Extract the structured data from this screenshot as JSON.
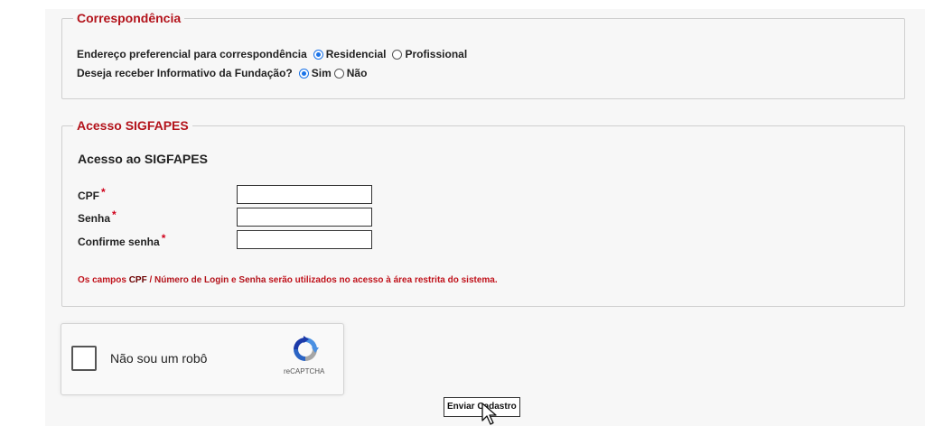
{
  "correspondencia": {
    "legend": "Correspondência",
    "endereco_label": "Endereço preferencial para correspondência",
    "endereco_options": [
      "Residencial",
      "Profissional"
    ],
    "endereco_selected": "Residencial",
    "informativo_label": "Deseja receber Informativo da Fundação?",
    "informativo_options": [
      "Sim",
      "Não"
    ],
    "informativo_selected": "Sim"
  },
  "acesso": {
    "legend": "Acesso SIGFAPES",
    "subtitle": "Acesso ao SIGFAPES",
    "fields": [
      {
        "label": "CPF",
        "value": ""
      },
      {
        "label": "Senha",
        "value": ""
      },
      {
        "label": "Confirme senha",
        "value": ""
      }
    ],
    "required_mark": "*",
    "note": {
      "prefix": "Os campos ",
      "cpf": "CPF",
      "sep": " / ",
      "login": "Número de Login",
      "and": " e ",
      "senha": "Senha",
      "suffix": " serão utilizados no acesso à área restrita do sistema."
    }
  },
  "captcha": {
    "text": "Não sou um robô",
    "brand": "reCAPTCHA",
    "icon": "recaptcha-logo-icon"
  },
  "submit_label": "Enviar Cadastro",
  "colors": {
    "accent_red": "#b3131b",
    "radio_blue": "#1a73e8",
    "background": "#f7f7f7"
  }
}
